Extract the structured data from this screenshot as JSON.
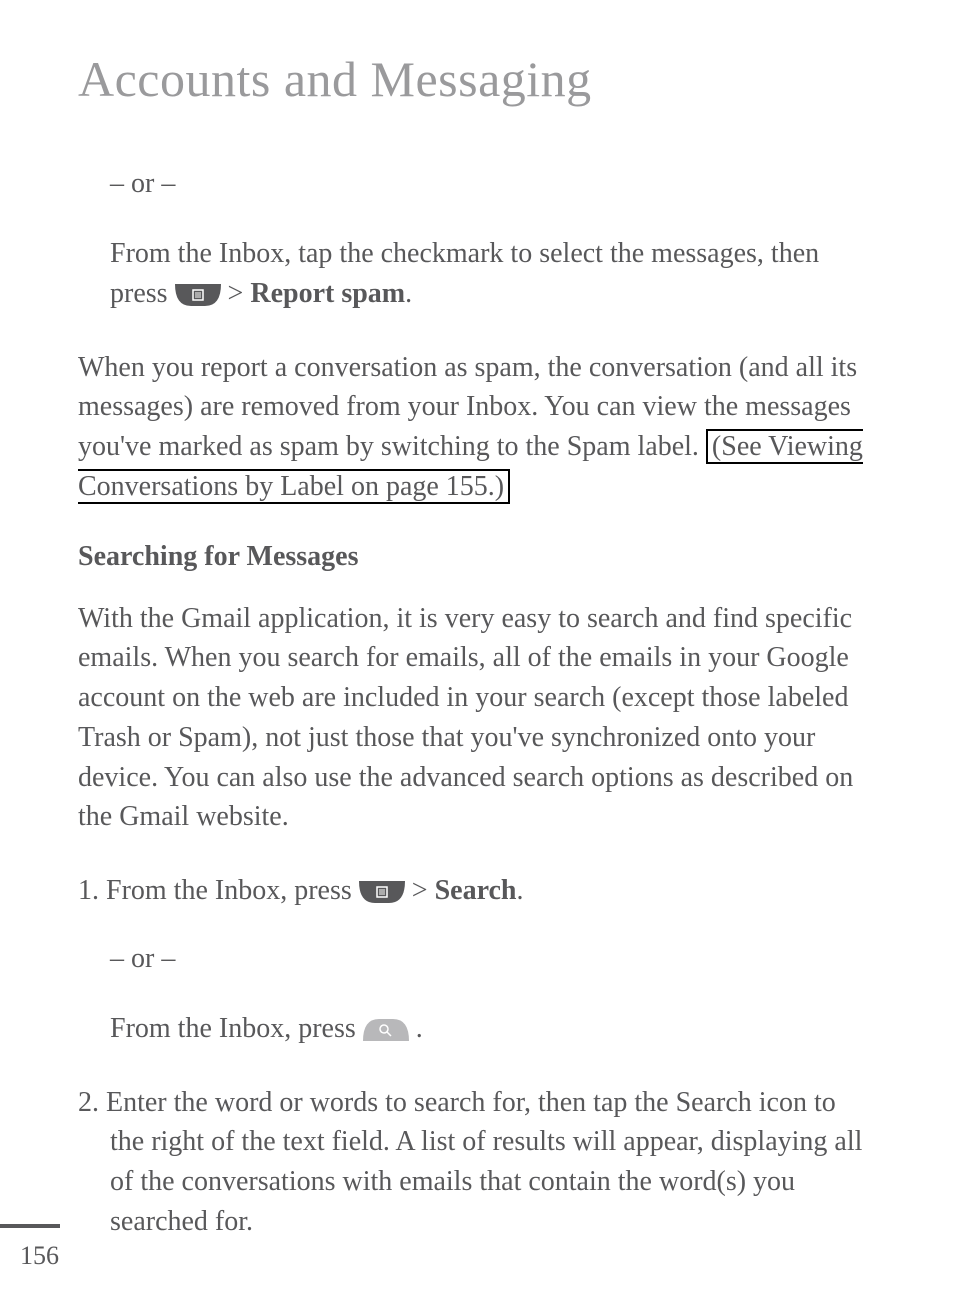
{
  "title": "Accounts and Messaging",
  "or_label": "– or –",
  "report_spam_pre": "From the Inbox, tap the checkmark to select the messages, then press ",
  "report_spam_gt": " > ",
  "report_spam_bold": "Report spam",
  "period": ".",
  "spam_body_pre": "When you report a conversation as spam, the conversation (and all its messages) are removed from your Inbox. You can view the messages you've marked as spam by switching to the Spam label. ",
  "spam_body_boxed": "(See Viewing Conversations by Label on page 155.)",
  "searching_heading": "Searching for Messages",
  "searching_body": "With the Gmail application, it is very easy to search and find specific emails. When you search for emails, all of the emails in your Google account on the web are included in your search (except those labeled Trash or Spam), not just those that you've synchronized onto your device. You can also use the advanced search options as described on the Gmail website.",
  "step1_pre": "1. From the Inbox, press ",
  "step1_gt": " > ",
  "step1_bold": "Search",
  "step1b_pre": "From the Inbox, press ",
  "step1b_post": " .",
  "step2_pre": "2. ",
  "step2_body": "Enter the word or words to search for, then tap the Search icon to the right of the text field. A list of results will appear, displaying all of the conversations with emails that contain the word(s) you searched for.",
  "page_number": "156"
}
